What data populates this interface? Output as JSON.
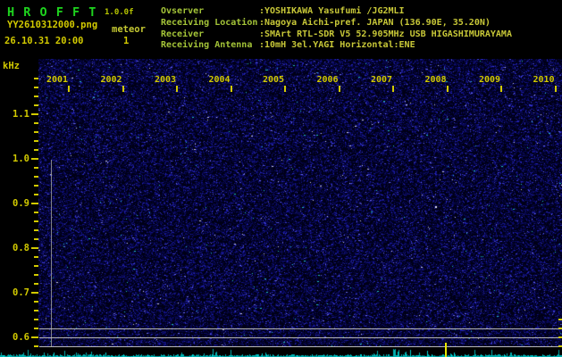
{
  "app": {
    "title": "H R O F F T",
    "version": "1.0.0f",
    "filename": "YY2610312000.png",
    "channel": "meteor",
    "datetime": "26.10.31 20:00",
    "count": "1"
  },
  "station": {
    "rows": [
      {
        "label": "Ovserver",
        "value": ":YOSHIKAWA Yasufumi /JG2MLI"
      },
      {
        "label": "Receiving Location",
        "value": ":Nagoya Aichi-pref. JAPAN (136.90E, 35.20N)"
      },
      {
        "label": "Receiver",
        "value": ":SMArt RTL-SDR V5 52.905MHz USB HIGASHIMURAYAMA"
      },
      {
        "label": "Receiving Antenna",
        "value": ":10mH 3el.YAGI Horizontal:ENE"
      }
    ]
  },
  "chart_data": {
    "type": "heatmap",
    "title": "HROFFT 10-minute radio meteor spectrogram, background noise only (no strong echoes)",
    "ylabel": "kHz",
    "y_major_ticks": [
      1.1,
      1.0,
      0.9,
      0.8,
      0.7,
      0.6
    ],
    "y_minor_step_khz": 0.02,
    "y_range_khz": [
      0.576,
      1.224
    ],
    "x_tick_labels": [
      "2001",
      "2002",
      "2003",
      "2004",
      "2005",
      "2006",
      "2007",
      "2008",
      "2009",
      "2010"
    ],
    "x_meaning": "local time 20:01 - 20:10",
    "reference_lines_khz": [
      0.62,
      0.6,
      0.58
    ],
    "carrier_trace": "faint vertical grey line near left edge below 1.0 kHz",
    "event_marker": {
      "at_label": "2008",
      "color": "#e8e800"
    },
    "signal_meter": "cyan noise-level strip along bottom edge",
    "legend": "none",
    "grid": "off",
    "palette": {
      "background": "#000016",
      "noise_blues": [
        "#050540",
        "#0a0a66",
        "#15158f",
        "#2626bb",
        "#3d3dd6",
        "#6a6aee"
      ],
      "noise_cyan": "#22c4c4",
      "noise_white": "#cfcfef",
      "meter_cyan": "#00b0b0",
      "axis_yellow": "#d2ca00",
      "reference_line_grey": "#b8b8b8",
      "carrier_line_grey": "#9a9a9a"
    }
  },
  "colors": {
    "title_green": "#1ed41e",
    "version_yellow_green": "#b6c400",
    "header_yellow": "#d2ca00",
    "channel_yellow_green": "#c4c832",
    "info_label_green": "#a4c438",
    "info_value_yellow": "#c8c838"
  }
}
